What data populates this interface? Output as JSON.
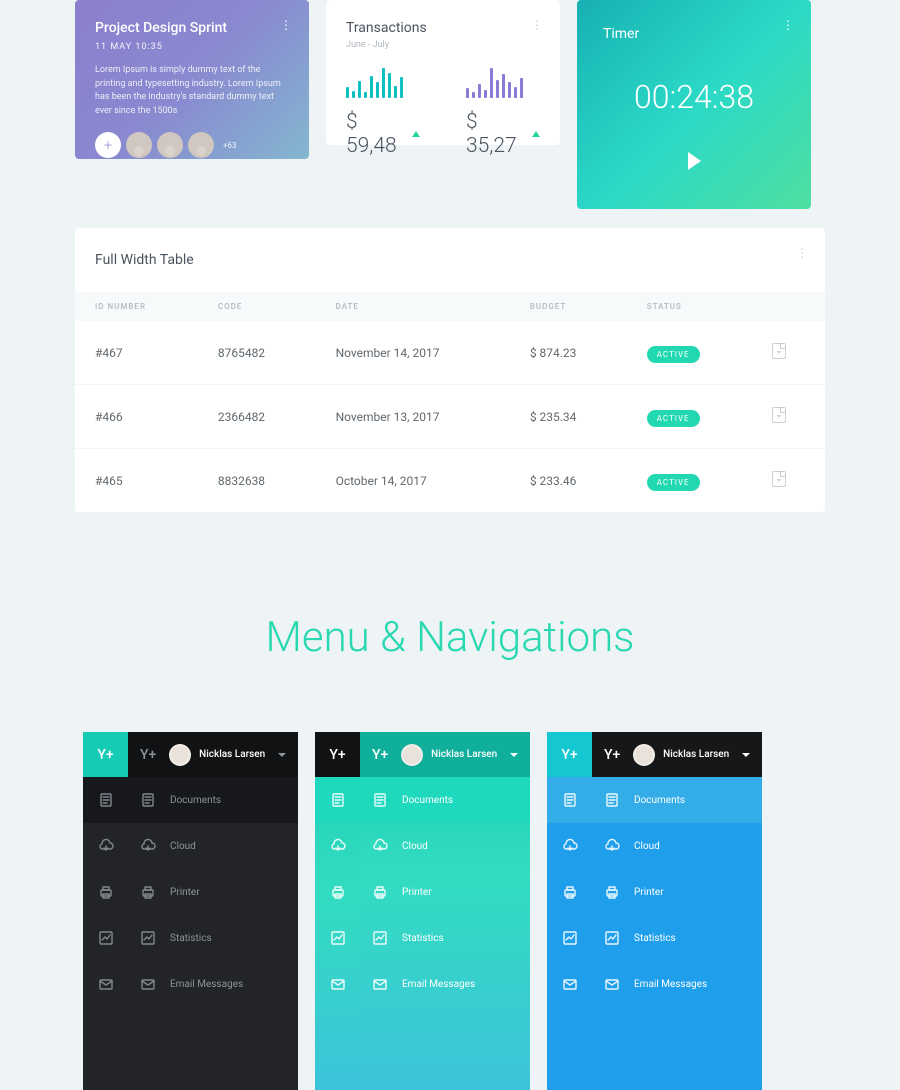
{
  "project": {
    "title": "Project Design Sprint",
    "date": "11 MAY 10:35",
    "desc": "Lorem Ipsum is simply dummy text of the printing and typesetting industry. Lorem Ipsum has been the industry's standard dummy text ever since the 1500s",
    "more": "+63"
  },
  "transactions": {
    "title": "Transactions",
    "sub": "June - July",
    "val1": "$ 59,48",
    "val2": "$ 35,27"
  },
  "chart_data": [
    {
      "type": "bar",
      "values": [
        12,
        8,
        18,
        6,
        24,
        17,
        32,
        27,
        13,
        22
      ],
      "ylim": [
        0,
        32
      ],
      "title": "",
      "xlabel": "",
      "ylabel": ""
    },
    {
      "type": "bar",
      "values": [
        10,
        6,
        14,
        8,
        30,
        18,
        24,
        16,
        11,
        20
      ],
      "ylim": [
        0,
        30
      ],
      "title": "",
      "xlabel": "",
      "ylabel": ""
    }
  ],
  "timer": {
    "title": "Timer",
    "value": "00:24:38"
  },
  "table": {
    "title": "Full Width Table",
    "headers": [
      "ID NUMBER",
      "CODE",
      "DATE",
      "BUDGET",
      "STATUS"
    ],
    "rows": [
      {
        "id": "#467",
        "code": "8765482",
        "date": "November 14, 2017",
        "budget": "$ 874.23",
        "status": "ACTIVE"
      },
      {
        "id": "#466",
        "code": "2366482",
        "date": "November 13, 2017",
        "budget": "$ 235.34",
        "status": "ACTIVE"
      },
      {
        "id": "#465",
        "code": "8832638",
        "date": "October 14, 2017",
        "budget": "$ 233.46",
        "status": "ACTIVE"
      }
    ]
  },
  "section_title": "Menu & Navigations",
  "menu": {
    "logo": "Y+",
    "user": "Nicklas Larsen",
    "items": [
      {
        "label": "Documents",
        "icon": "documents"
      },
      {
        "label": "Cloud",
        "icon": "cloud"
      },
      {
        "label": "Printer",
        "icon": "printer"
      },
      {
        "label": "Statistics",
        "icon": "statistics"
      },
      {
        "label": "Email Messages",
        "icon": "email"
      }
    ]
  }
}
